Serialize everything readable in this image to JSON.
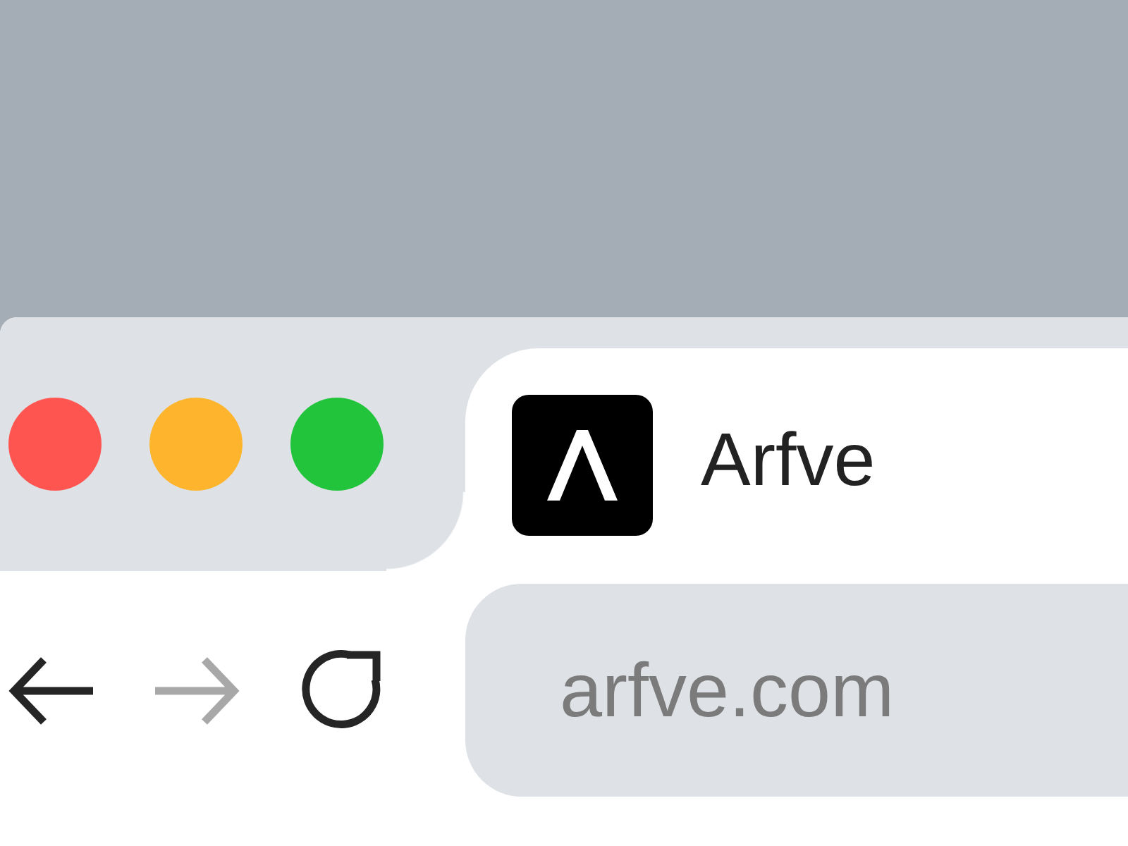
{
  "window": {
    "controls": [
      {
        "color": "#ff5550"
      },
      {
        "color": "#feb52d"
      },
      {
        "color": "#21c43b"
      }
    ]
  },
  "tab": {
    "title": "Arfve",
    "selected": true
  },
  "toolbar": {
    "buttons": [
      {
        "kind": "back",
        "disabled": false
      },
      {
        "kind": "forward",
        "disabled": true
      },
      {
        "kind": "reload",
        "disabled": false
      }
    ]
  },
  "address_bar": {
    "value": "arfve.com"
  }
}
